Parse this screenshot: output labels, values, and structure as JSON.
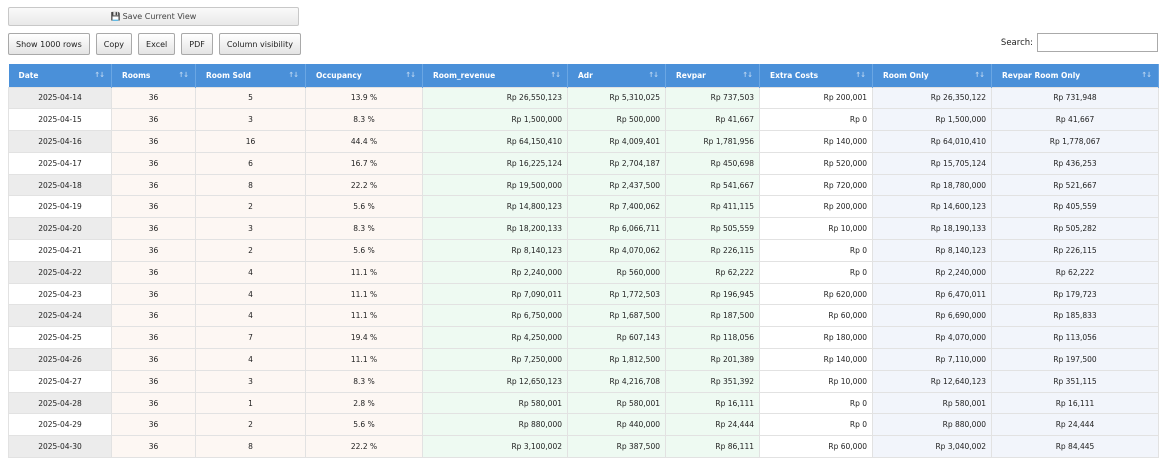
{
  "toolbar": {
    "save_view": "Save Current View",
    "buttons": [
      "Show 1000 rows",
      "Copy",
      "Excel",
      "PDF",
      "Column visibility"
    ],
    "search_label": "Search:",
    "search_value": ""
  },
  "table": {
    "headers": [
      "Date",
      "Rooms",
      "Room Sold",
      "Occupancy",
      "Room_revenue",
      "Adr",
      "Revpar",
      "Extra Costs",
      "Room Only",
      "Revpar Room Only"
    ],
    "rows": [
      [
        "2025-04-14",
        "36",
        "5",
        "13.9 %",
        "Rp 26,550,123",
        "Rp 5,310,025",
        "Rp 737,503",
        "Rp 200,001",
        "Rp 26,350,122",
        "Rp 731,948"
      ],
      [
        "2025-04-15",
        "36",
        "3",
        "8.3 %",
        "Rp 1,500,000",
        "Rp 500,000",
        "Rp 41,667",
        "Rp 0",
        "Rp 1,500,000",
        "Rp 41,667"
      ],
      [
        "2025-04-16",
        "36",
        "16",
        "44.4 %",
        "Rp 64,150,410",
        "Rp 4,009,401",
        "Rp 1,781,956",
        "Rp 140,000",
        "Rp 64,010,410",
        "Rp 1,778,067"
      ],
      [
        "2025-04-17",
        "36",
        "6",
        "16.7 %",
        "Rp 16,225,124",
        "Rp 2,704,187",
        "Rp 450,698",
        "Rp 520,000",
        "Rp 15,705,124",
        "Rp 436,253"
      ],
      [
        "2025-04-18",
        "36",
        "8",
        "22.2 %",
        "Rp 19,500,000",
        "Rp 2,437,500",
        "Rp 541,667",
        "Rp 720,000",
        "Rp 18,780,000",
        "Rp 521,667"
      ],
      [
        "2025-04-19",
        "36",
        "2",
        "5.6 %",
        "Rp 14,800,123",
        "Rp 7,400,062",
        "Rp 411,115",
        "Rp 200,000",
        "Rp 14,600,123",
        "Rp 405,559"
      ],
      [
        "2025-04-20",
        "36",
        "3",
        "8.3 %",
        "Rp 18,200,133",
        "Rp 6,066,711",
        "Rp 505,559",
        "Rp 10,000",
        "Rp 18,190,133",
        "Rp 505,282"
      ],
      [
        "2025-04-21",
        "36",
        "2",
        "5.6 %",
        "Rp 8,140,123",
        "Rp 4,070,062",
        "Rp 226,115",
        "Rp 0",
        "Rp 8,140,123",
        "Rp 226,115"
      ],
      [
        "2025-04-22",
        "36",
        "4",
        "11.1 %",
        "Rp 2,240,000",
        "Rp 560,000",
        "Rp 62,222",
        "Rp 0",
        "Rp 2,240,000",
        "Rp 62,222"
      ],
      [
        "2025-04-23",
        "36",
        "4",
        "11.1 %",
        "Rp 7,090,011",
        "Rp 1,772,503",
        "Rp 196,945",
        "Rp 620,000",
        "Rp 6,470,011",
        "Rp 179,723"
      ],
      [
        "2025-04-24",
        "36",
        "4",
        "11.1 %",
        "Rp 6,750,000",
        "Rp 1,687,500",
        "Rp 187,500",
        "Rp 60,000",
        "Rp 6,690,000",
        "Rp 185,833"
      ],
      [
        "2025-04-25",
        "36",
        "7",
        "19.4 %",
        "Rp 4,250,000",
        "Rp 607,143",
        "Rp 118,056",
        "Rp 180,000",
        "Rp 4,070,000",
        "Rp 113,056"
      ],
      [
        "2025-04-26",
        "36",
        "4",
        "11.1 %",
        "Rp 7,250,000",
        "Rp 1,812,500",
        "Rp 201,389",
        "Rp 140,000",
        "Rp 7,110,000",
        "Rp 197,500"
      ],
      [
        "2025-04-27",
        "36",
        "3",
        "8.3 %",
        "Rp 12,650,123",
        "Rp 4,216,708",
        "Rp 351,392",
        "Rp 10,000",
        "Rp 12,640,123",
        "Rp 351,115"
      ],
      [
        "2025-04-28",
        "36",
        "1",
        "2.8 %",
        "Rp 580,001",
        "Rp 580,001",
        "Rp 16,111",
        "Rp 0",
        "Rp 580,001",
        "Rp 16,111"
      ],
      [
        "2025-04-29",
        "36",
        "2",
        "5.6 %",
        "Rp 880,000",
        "Rp 440,000",
        "Rp 24,444",
        "Rp 0",
        "Rp 880,000",
        "Rp 24,444"
      ],
      [
        "2025-04-30",
        "36",
        "8",
        "22.2 %",
        "Rp 3,100,002",
        "Rp 387,500",
        "Rp 86,111",
        "Rp 60,000",
        "Rp 3,040,002",
        "Rp 84,445"
      ]
    ]
  }
}
